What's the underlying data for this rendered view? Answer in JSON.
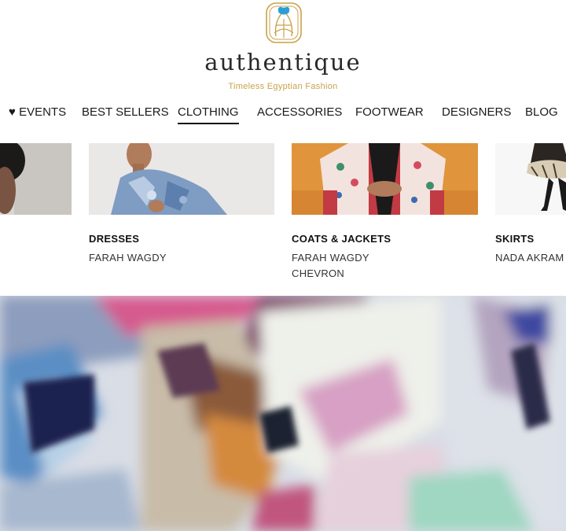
{
  "brand": {
    "name": "authentique",
    "tagline": "Timeless Egyptian Fashion",
    "accent_color": "#c9a24a"
  },
  "nav": {
    "items": [
      {
        "label": "♥ EVENTS"
      },
      {
        "label": "BEST SELLERS"
      },
      {
        "label": "CLOTHING",
        "active": true
      },
      {
        "label": "ACCESSORIES"
      },
      {
        "label": "FOOTWEAR"
      },
      {
        "label": "DESIGNERS"
      },
      {
        "label": "BLOG"
      }
    ]
  },
  "dropdown": {
    "categories": [
      {
        "title": "DRESSES",
        "links": [
          "FARAH WAGDY"
        ]
      },
      {
        "title": "COATS & JACKETS",
        "links": [
          "FARAH WAGDY",
          "CHEVRON"
        ]
      },
      {
        "title": "SKIRTS",
        "links": [
          "NADA AKRAM"
        ]
      }
    ]
  }
}
